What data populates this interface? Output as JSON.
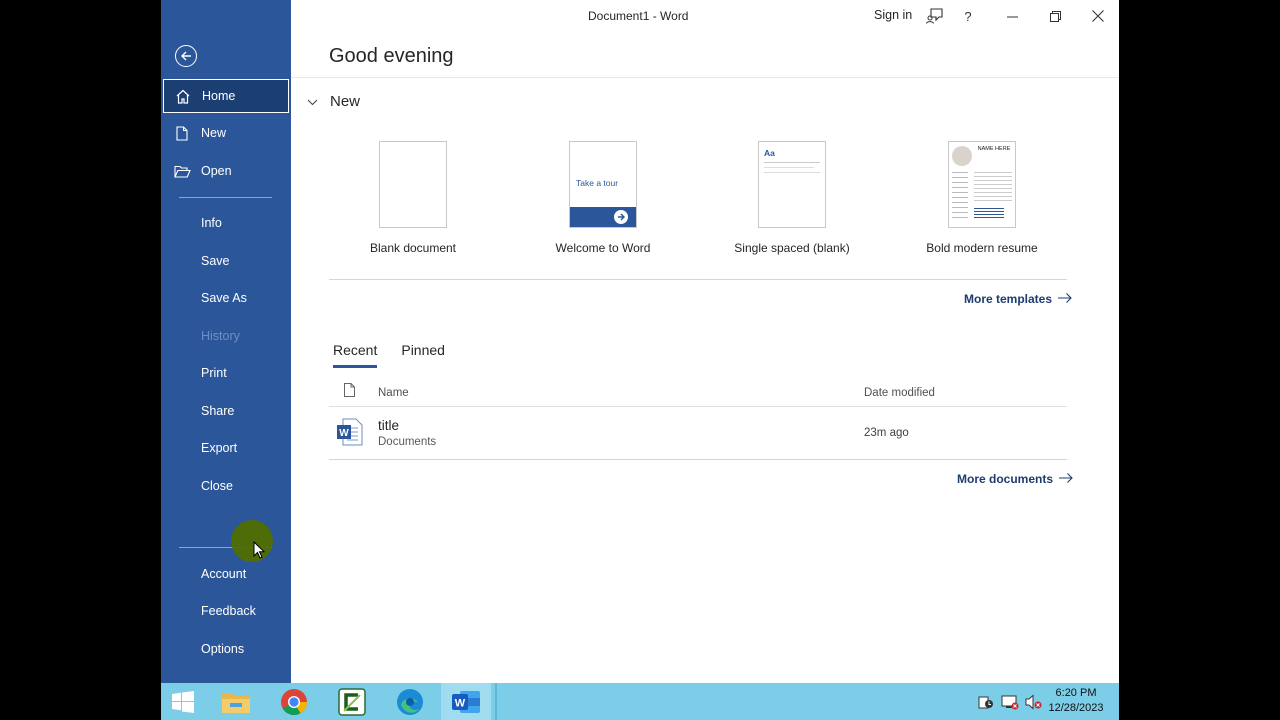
{
  "window": {
    "title": "Document1  -  Word",
    "signin_label": "Sign in",
    "help_label": "?"
  },
  "sidebar": {
    "items": [
      {
        "label": "Home"
      },
      {
        "label": "New"
      },
      {
        "label": "Open"
      },
      {
        "label": "Info"
      },
      {
        "label": "Save"
      },
      {
        "label": "Save As"
      },
      {
        "label": "History"
      },
      {
        "label": "Print"
      },
      {
        "label": "Share"
      },
      {
        "label": "Export"
      },
      {
        "label": "Close"
      },
      {
        "label": "Account"
      },
      {
        "label": "Feedback"
      },
      {
        "label": "Options"
      }
    ],
    "colors": {
      "background": "#2b579a",
      "active": "#1b3f73",
      "disabled_text": "#6d8fc4"
    }
  },
  "main": {
    "greeting": "Good evening",
    "new_section_label": "New",
    "templates": [
      {
        "label": "Blank document"
      },
      {
        "label": "Welcome to Word",
        "thumb_text": "Take a tour"
      },
      {
        "label": "Single spaced (blank)",
        "thumb_text": "Aa"
      },
      {
        "label": "Bold modern resume",
        "thumb_text": "NAME HERE"
      }
    ],
    "more_templates_label": "More templates",
    "tabs": [
      {
        "label": "Recent",
        "active": true
      },
      {
        "label": "Pinned",
        "active": false
      }
    ],
    "list_header": {
      "name": "Name",
      "date": "Date modified"
    },
    "files": [
      {
        "name": "title",
        "location": "Documents",
        "modified": "23m ago",
        "icon": "word-doc-icon"
      }
    ],
    "more_documents_label": "More documents"
  },
  "taskbar": {
    "apps": [
      "start-icon",
      "file-explorer-icon",
      "chrome-icon",
      "camtasia-icon",
      "edge-icon",
      "word-icon"
    ],
    "time": "6:20 PM",
    "date": "12/28/2023",
    "color": "#7ccde8"
  }
}
